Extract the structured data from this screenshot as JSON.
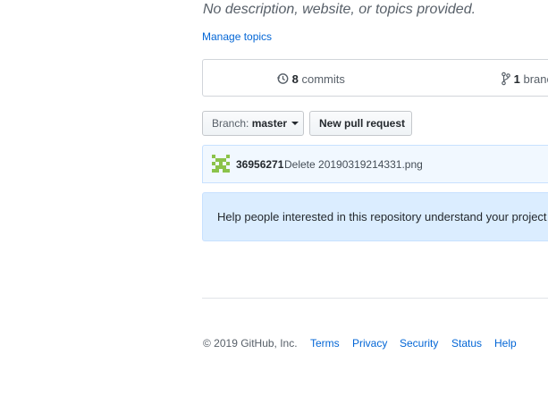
{
  "repo": {
    "description": "No description, website, or topics provided.",
    "manage_topics_label": "Manage topics"
  },
  "summary": {
    "commits_count": "8",
    "commits_label": "commits",
    "branches_count": "1",
    "branches_label": "branch"
  },
  "toolbar": {
    "branch_label": "Branch:",
    "branch_value": "master",
    "new_pull_request_label": "New pull request"
  },
  "latest_commit": {
    "sha": "36956271",
    "message": "Delete 20190319214331.png"
  },
  "readme_prompt": {
    "text": "Help people interested in this repository understand your project by adding a README."
  },
  "footer": {
    "copyright": "© 2019 GitHub, Inc.",
    "links": [
      "Terms",
      "Privacy",
      "Security",
      "Status",
      "Help"
    ]
  },
  "colors": {
    "link": "#0366d6",
    "commit_bg": "#f1f8ff",
    "readme_bg": "#dbedff",
    "avatar_green": "#8bc34a"
  },
  "icons": {
    "commits": "history-icon",
    "branches": "git-branch-icon",
    "avatar": "identicon-avatar"
  }
}
